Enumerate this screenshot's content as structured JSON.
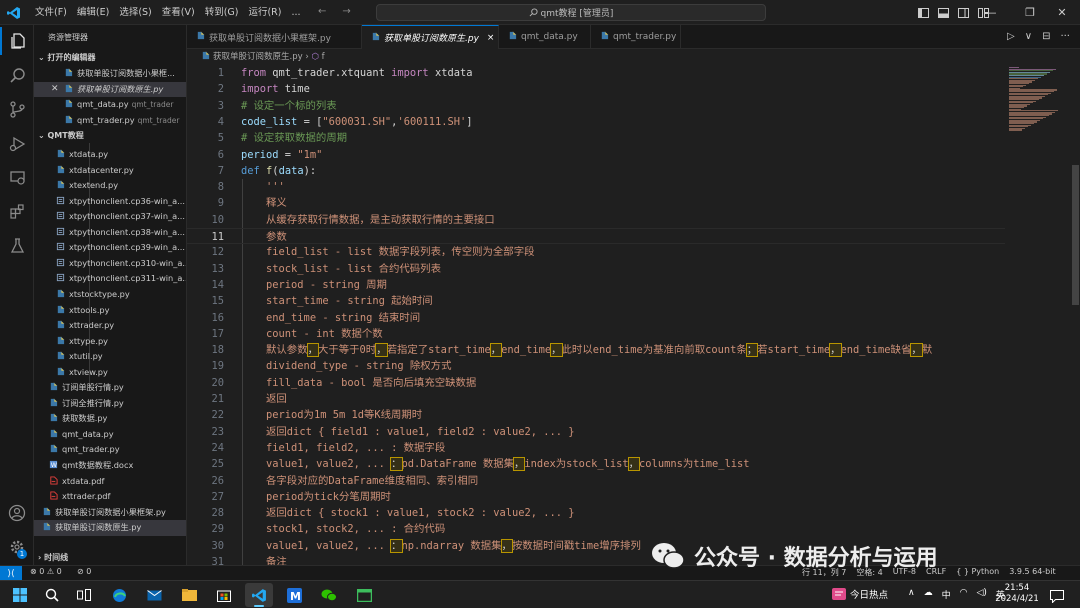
{
  "titlebar": {
    "menu": [
      "文件(F)",
      "编辑(E)",
      "选择(S)",
      "查看(V)",
      "转到(G)",
      "运行(R)",
      "..."
    ],
    "search_text": "qmt教程 [管理员]"
  },
  "activity": {
    "icons": [
      "files-icon",
      "search-icon",
      "source-control-icon",
      "run-debug-icon",
      "remote-explorer-icon",
      "extensions-icon",
      "testing-icon"
    ],
    "account_icon": "account-icon",
    "settings_icon": "manage-gear-icon",
    "badge": "1"
  },
  "sidebar": {
    "title": "资源管理器",
    "open_editors_title": "打开的编辑器",
    "open_editors": [
      {
        "name": "获取单股订阅数据小果框...",
        "desc": "",
        "type": "py"
      },
      {
        "name": "获取单股订阅数原生.py",
        "desc": "",
        "type": "py",
        "selected": true
      },
      {
        "name": "qmt_data.py",
        "desc": "qmt_trader",
        "type": "py"
      },
      {
        "name": "qmt_trader.py",
        "desc": "qmt_trader",
        "type": "py"
      }
    ],
    "folder_title": "QMT教程",
    "files": [
      {
        "name": "xtdata.py",
        "type": "py",
        "level": 2
      },
      {
        "name": "xtdatacenter.py",
        "type": "py",
        "level": 2
      },
      {
        "name": "xtextend.py",
        "type": "py",
        "level": 2
      },
      {
        "name": "xtpythonclient.cp36-win_a...",
        "type": "pyd",
        "level": 2
      },
      {
        "name": "xtpythonclient.cp37-win_a...",
        "type": "pyd",
        "level": 2
      },
      {
        "name": "xtpythonclient.cp38-win_a...",
        "type": "pyd",
        "level": 2
      },
      {
        "name": "xtpythonclient.cp39-win_a...",
        "type": "pyd",
        "level": 2
      },
      {
        "name": "xtpythonclient.cp310-win_a...",
        "type": "pyd",
        "level": 2
      },
      {
        "name": "xtpythonclient.cp311-win_a...",
        "type": "pyd",
        "level": 2
      },
      {
        "name": "xtstocktype.py",
        "type": "py",
        "level": 2
      },
      {
        "name": "xttools.py",
        "type": "py",
        "level": 2
      },
      {
        "name": "xttrader.py",
        "type": "py",
        "level": 2
      },
      {
        "name": "xttype.py",
        "type": "py",
        "level": 2
      },
      {
        "name": "xtutil.py",
        "type": "py",
        "level": 2
      },
      {
        "name": "xtview.py",
        "type": "py",
        "level": 2
      },
      {
        "name": "订阅单股行情.py",
        "type": "py",
        "level": 1
      },
      {
        "name": "订阅全推行情.py",
        "type": "py",
        "level": 1
      },
      {
        "name": "获取数据.py",
        "type": "py",
        "level": 1
      },
      {
        "name": "qmt_data.py",
        "type": "py",
        "level": 1
      },
      {
        "name": "qmt_trader.py",
        "type": "py",
        "level": 1
      },
      {
        "name": "qmt数据教程.docx",
        "type": "docx",
        "level": 1
      },
      {
        "name": "xtdata.pdf",
        "type": "pdf",
        "level": 1
      },
      {
        "name": "xttrader.pdf",
        "type": "pdf",
        "level": 1
      },
      {
        "name": "获取单股订阅数据小果框架.py",
        "type": "py",
        "level": 0
      },
      {
        "name": "获取单股订阅数原生.py",
        "type": "py",
        "level": 0,
        "selected": true
      }
    ],
    "timeline_title": "时间线"
  },
  "tabs": [
    {
      "label": "获取单股订阅数据小果框架.py",
      "active": false
    },
    {
      "label": "获取单股订阅数原生.py",
      "active": true,
      "close": "×"
    },
    {
      "label": "qmt_data.py",
      "active": false
    },
    {
      "label": "qmt_trader.py",
      "active": false
    }
  ],
  "tab_actions": [
    "▷",
    "∨",
    "⊟",
    "···"
  ],
  "breadcrumb": {
    "file": "获取单股订阅数原生.py",
    "sep": "›",
    "symbol": "f"
  },
  "editor": {
    "current_line": 11,
    "lines": [
      [
        [
          "kw",
          "from "
        ],
        [
          "op",
          "qmt_trader.xtquant "
        ],
        [
          "kw",
          "import "
        ],
        [
          "op",
          "xtdata"
        ]
      ],
      [
        [
          "kw",
          "import "
        ],
        [
          "op",
          "time"
        ]
      ],
      [
        [
          "cm",
          "# 设定一个标的列表"
        ]
      ],
      [
        [
          "vr",
          "code_list"
        ],
        [
          "op",
          " = ["
        ],
        [
          "str",
          "\"600031.SH\""
        ],
        [
          "op",
          ","
        ],
        [
          "str",
          "'600111.SH'"
        ],
        [
          "op",
          "]"
        ]
      ],
      [
        [
          "cm",
          "# 设定获取数据的周期"
        ]
      ],
      [
        [
          "vr",
          "period"
        ],
        [
          "op",
          " = "
        ],
        [
          "str",
          "\"1m\""
        ]
      ],
      [
        [
          "kw2",
          "def "
        ],
        [
          "fn",
          "f"
        ],
        [
          "op",
          "("
        ],
        [
          "vr",
          "data"
        ],
        [
          "op",
          "):"
        ]
      ],
      [
        [
          "ds",
          "    '''"
        ]
      ],
      [
        [
          "ds",
          "    释义"
        ]
      ],
      [
        [
          "ds",
          "    从缓存获取行情数据，是主动获取行情的主要接口"
        ]
      ],
      [
        [
          "ds",
          "    参数"
        ]
      ],
      [
        [
          "ds",
          "    field_list - list 数据字段列表，传空则为全部字段"
        ]
      ],
      [
        [
          "ds",
          "    stock_list - list 合约代码列表"
        ]
      ],
      [
        [
          "ds",
          "    period - string 周期"
        ]
      ],
      [
        [
          "ds",
          "    start_time - string 起始时间"
        ]
      ],
      [
        [
          "ds",
          "    end_time - string 结束时间"
        ]
      ],
      [
        [
          "ds",
          "    count - int 数据个数"
        ]
      ],
      [
        [
          "ds",
          "    默认参数"
        ],
        [
          "hl",
          "，"
        ],
        [
          "ds",
          "大于等于0时"
        ],
        [
          "hl",
          "，"
        ],
        [
          "ds",
          "若指定了start_time"
        ],
        [
          "hl",
          "，"
        ],
        [
          "ds",
          "end_time"
        ],
        [
          "hl",
          "，"
        ],
        [
          "ds",
          "此时以end_time为基准向前取count条"
        ],
        [
          "hl",
          "；"
        ],
        [
          "ds",
          "若start_time"
        ],
        [
          "hl",
          "，"
        ],
        [
          "ds",
          "end_time缺省"
        ],
        [
          "hl",
          "，"
        ],
        [
          "ds",
          "默"
        ]
      ],
      [
        [
          "ds",
          "    dividend_type - string 除权方式"
        ]
      ],
      [
        [
          "ds",
          "    fill_data - bool 是否向后填充空缺数据"
        ]
      ],
      [
        [
          "ds",
          "    返回"
        ]
      ],
      [
        [
          "ds",
          "    period为1m 5m 1d等K线周期时"
        ]
      ],
      [
        [
          "ds",
          "    返回dict { field1 : value1, field2 : value2, ... }"
        ]
      ],
      [
        [
          "ds",
          "    field1, field2, ... : 数据字段"
        ]
      ],
      [
        [
          "ds",
          "    value1, value2, ... "
        ],
        [
          "hl",
          "："
        ],
        [
          "ds",
          "pd.DataFrame 数据集"
        ],
        [
          "hl",
          "，"
        ],
        [
          "ds",
          "index为stock_list"
        ],
        [
          "hl",
          "，"
        ],
        [
          "ds",
          "columns为time_list"
        ]
      ],
      [
        [
          "ds",
          "    各字段对应的DataFrame维度相同、索引相同"
        ]
      ],
      [
        [
          "ds",
          "    period为tick分笔周期时"
        ]
      ],
      [
        [
          "ds",
          "    返回dict { stock1 : value1, stock2 : value2, ... }"
        ]
      ],
      [
        [
          "ds",
          "    stock1, stock2, ... : 合约代码"
        ]
      ],
      [
        [
          "ds",
          "    value1, value2, ... "
        ],
        [
          "hl",
          "："
        ],
        [
          "ds",
          "np.ndarray 数据集"
        ],
        [
          "hl",
          "，"
        ],
        [
          "ds",
          "按数据时间戳time增序排列"
        ]
      ],
      [
        [
          "ds",
          "    备注"
        ]
      ]
    ]
  },
  "statusbar": {
    "remote": "⟩⟨",
    "errors": "⊗ 0 ⚠ 0",
    "ports": "⊘ 0",
    "right": [
      "行 11，列 7",
      "空格: 4",
      "UTF-8",
      "CRLF",
      "{ } Python",
      "3.9.5 64-bit"
    ]
  },
  "taskbar": {
    "news_label": "今日热点",
    "tray": [
      "∧",
      "中",
      "英"
    ],
    "time": "21:54",
    "date": "2024/4/21"
  },
  "watermark": "公众号 · 数据分析与运用",
  "colors": {
    "accent": "#0078d4",
    "editor_bg": "#1f1f1f",
    "sidebar_bg": "#181818"
  }
}
